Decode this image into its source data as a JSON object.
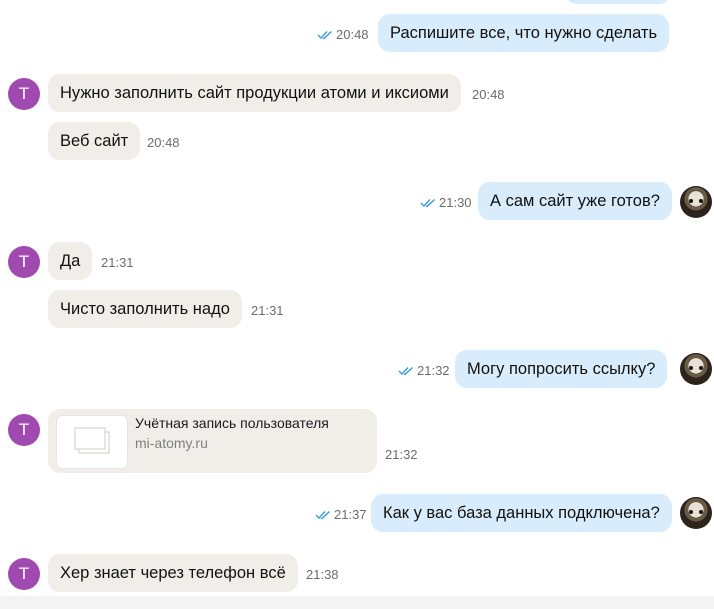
{
  "contact": {
    "avatar_letter": "T",
    "avatar_color": "#a04ab0"
  },
  "colors": {
    "incoming_bubble": "#f1eee9",
    "outgoing_bubble": "#d8ecfb",
    "read_ticks": "#3a9bd9"
  },
  "messages": [
    {
      "direction": "out",
      "text": "Распишите все, что нужно сделать",
      "time": "20:48",
      "status": "read"
    },
    {
      "direction": "in",
      "text": "Нужно заполнить сайт продукции атоми и иксиоми",
      "time": "20:48"
    },
    {
      "direction": "in",
      "text": "Веб сайт",
      "time": "20:48"
    },
    {
      "direction": "out",
      "text": "А сам сайт уже готов?",
      "time": "21:30",
      "status": "read"
    },
    {
      "direction": "in",
      "text": "Да",
      "time": "21:31"
    },
    {
      "direction": "in",
      "text": "Чисто заполнить надо",
      "time": "21:31"
    },
    {
      "direction": "out",
      "text": "Могу попросить ссылку?",
      "time": "21:32",
      "status": "read"
    },
    {
      "direction": "in",
      "type": "link",
      "title": "Учётная запись пользователя",
      "url": "mi-atomy.ru",
      "time": "21:32"
    },
    {
      "direction": "out",
      "text": "Как у вас база данных подключена?",
      "time": "21:37",
      "status": "read"
    },
    {
      "direction": "in",
      "text": "Хер знает через телефон всё",
      "time": "21:38"
    }
  ]
}
